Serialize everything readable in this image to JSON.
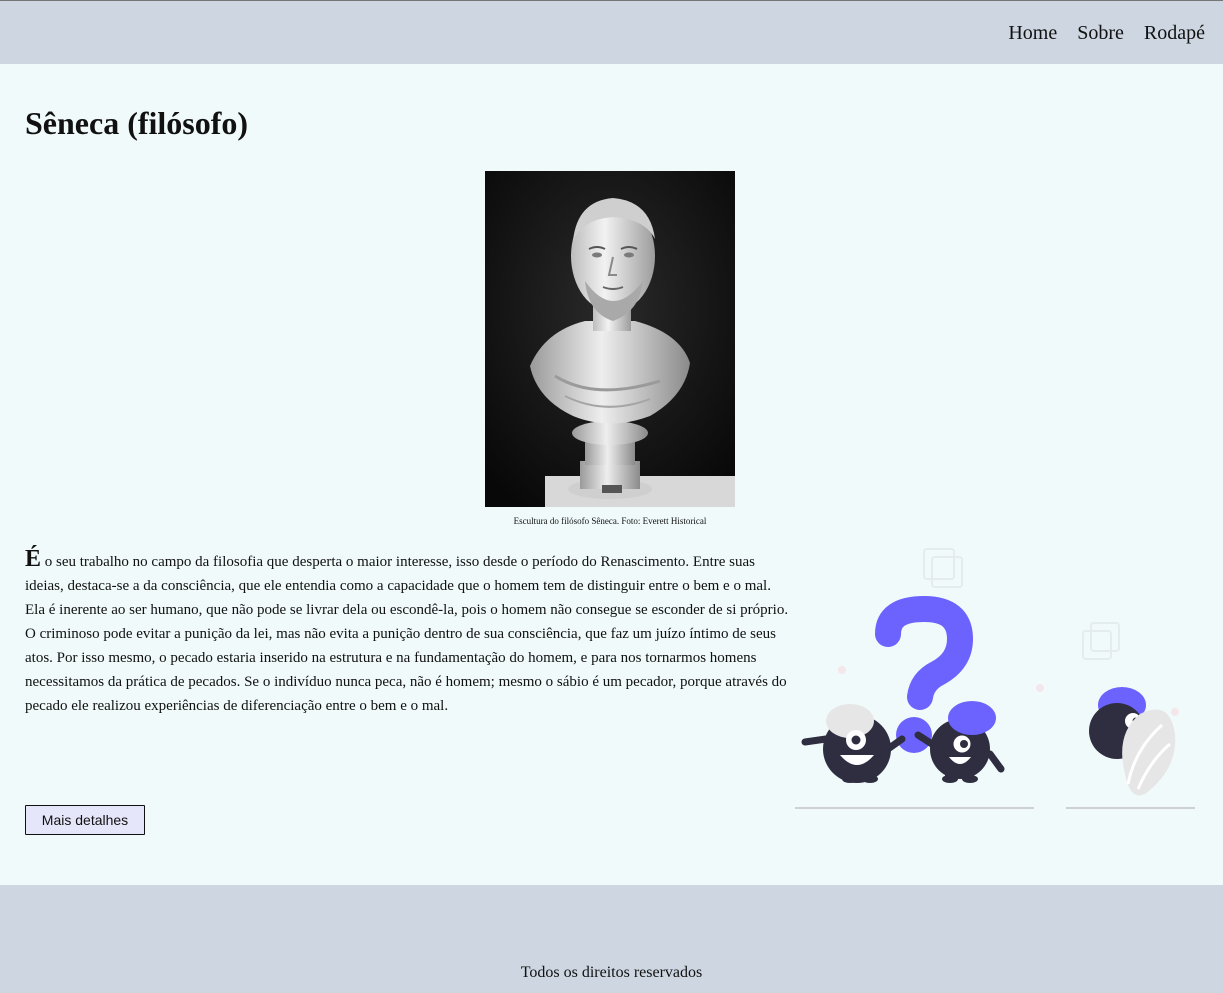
{
  "nav": {
    "items": [
      {
        "label": "Home"
      },
      {
        "label": "Sobre"
      },
      {
        "label": "Rodapé"
      }
    ]
  },
  "main": {
    "title": "Sêneca (filósofo)",
    "figure": {
      "caption": "Escultura do filósofo Sêneca. Foto: Everett Historical"
    },
    "article": {
      "dropcap": "É",
      "text": " o seu trabalho no campo da filosofia que desperta o maior interesse, isso desde o período do Renascimento. Entre suas ideias, destaca-se a da consciência, que ele entendia como a capacidade que o homem tem de distinguir entre o bem e o mal. Ela é inerente ao ser humano, que não pode se livrar dela ou escondê-la, pois o homem não consegue se esconder de si próprio. O criminoso pode evitar a punição da lei, mas não evita a punição dentro de sua consciência, que faz um juízo íntimo de seus atos. Por isso mesmo, o pecado estaria inserido na estrutura e na fundamentação do homem, e para nos tornarmos homens necessitamos da prática de pecados. Se o indivíduo nunca peca, não é homem; mesmo o sábio é um pecador, porque através do pecado ele realizou experiências de diferenciação entre o bem e o mal."
    },
    "button_label": "Mais detalhes"
  },
  "footer": {
    "copyright": "Todos os direitos reservados"
  },
  "colors": {
    "header_bg": "#cdd6e1",
    "page_bg": "#f0fafa",
    "accent": "#6c63ff",
    "button_bg": "#e6e6fb",
    "dark": "#2f2e41"
  }
}
